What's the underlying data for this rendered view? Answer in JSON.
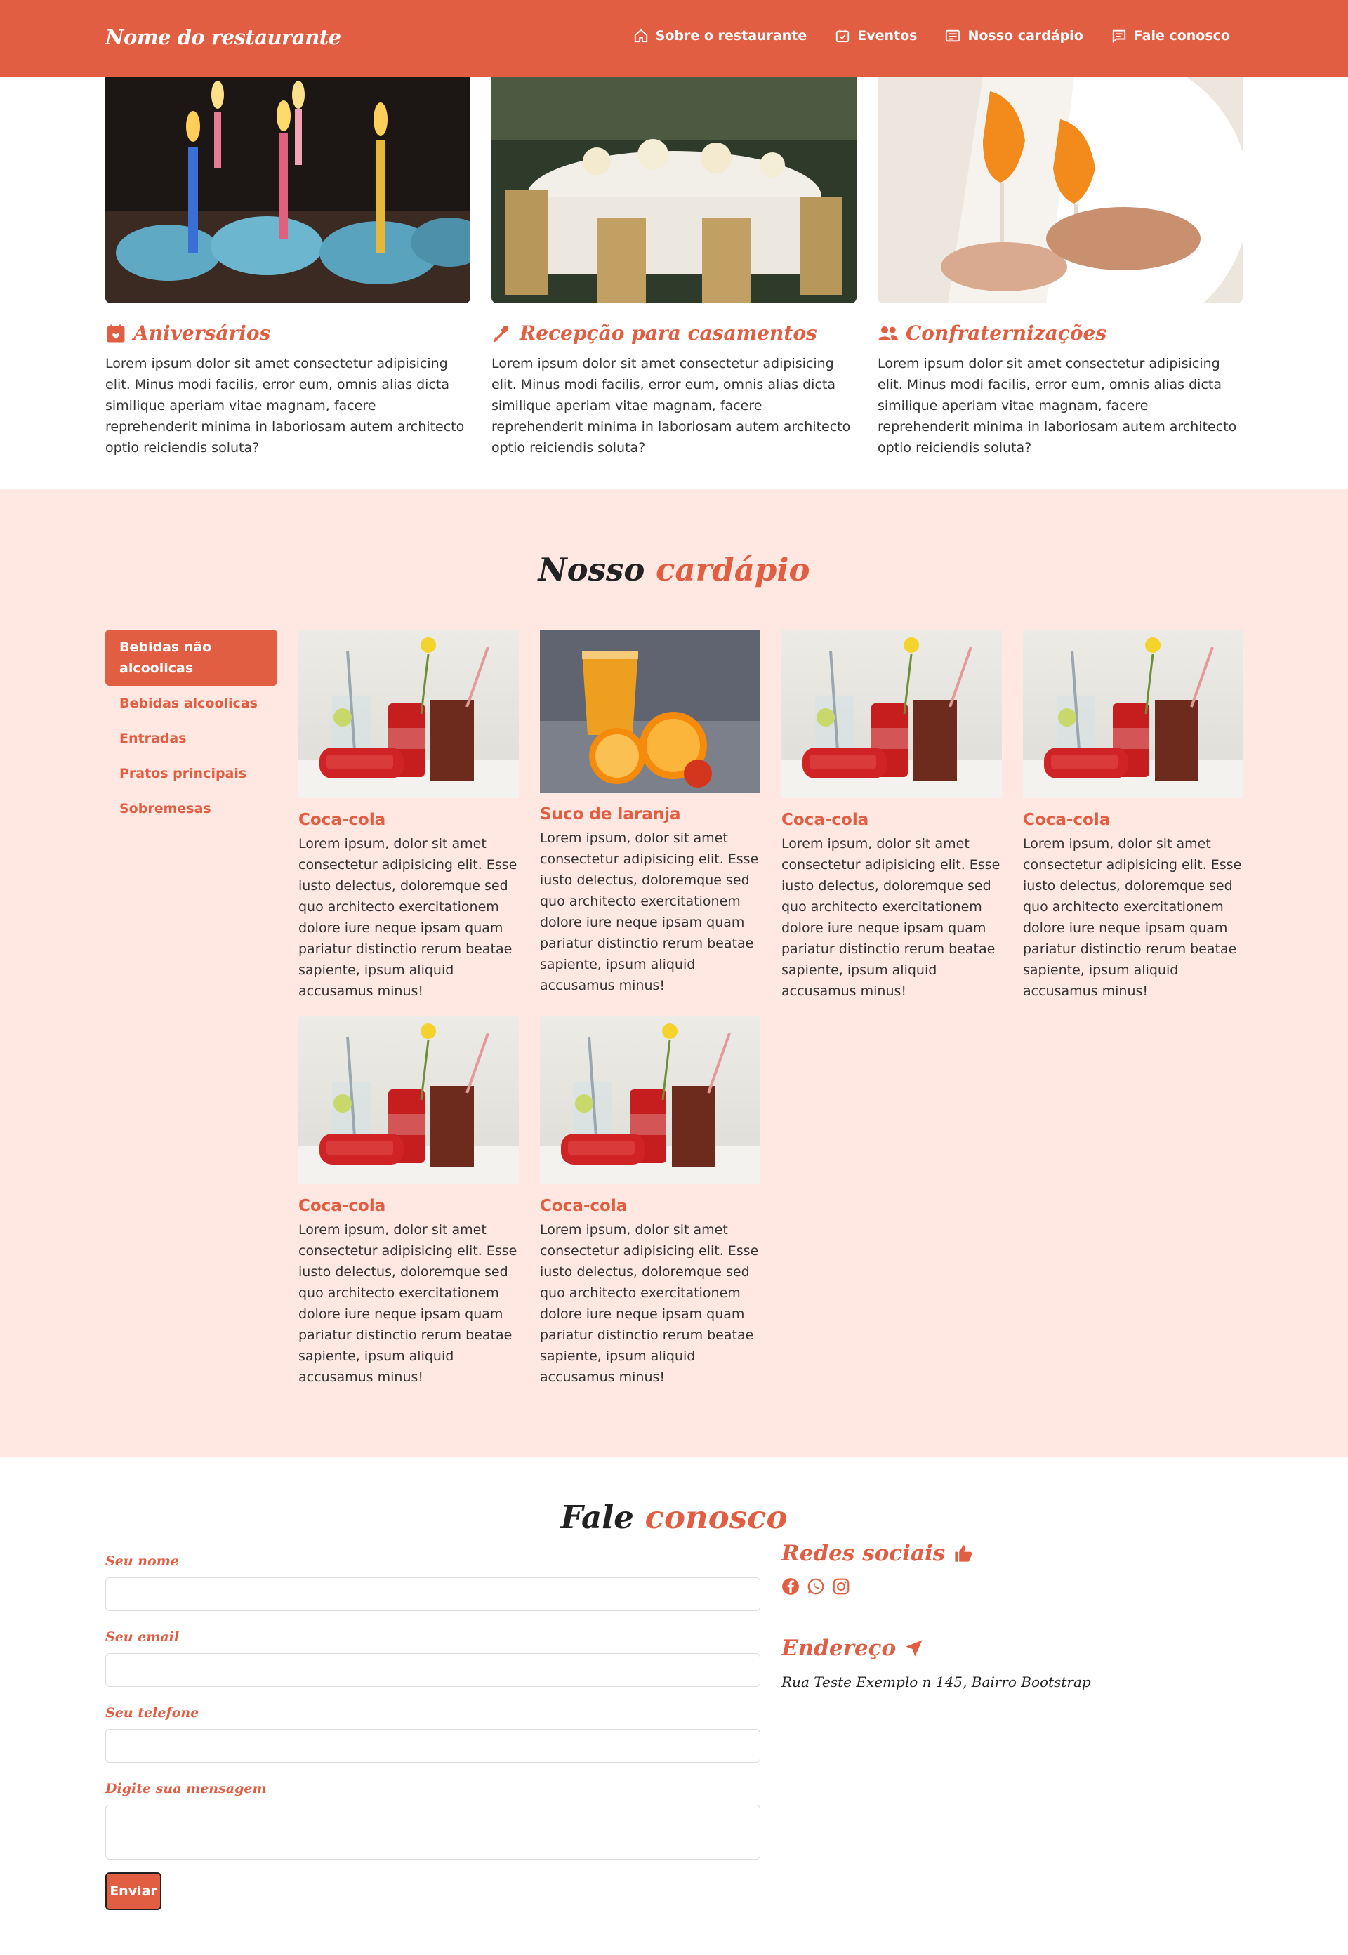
{
  "navbar": {
    "brand": "Nome do restaurante",
    "links": [
      {
        "label": "Sobre o restaurante",
        "icon": "house-icon"
      },
      {
        "label": "Eventos",
        "icon": "calendar-check-icon"
      },
      {
        "label": "Nosso cardápio",
        "icon": "card-text-icon"
      },
      {
        "label": "Fale conosco",
        "icon": "chat-icon"
      }
    ]
  },
  "events": [
    {
      "title": "Aniversários",
      "icon": "calendar-heart-icon",
      "text": "Lorem ipsum dolor sit amet consectetur adipisicing elit. Minus modi facilis, error eum, omnis alias dicta similique aperiam vitae magnam, facere reprehenderit minima in laboriosam autem architecto optio reiciendis soluta?"
    },
    {
      "title": "Recepção para casamentos",
      "icon": "hearts-arrow-icon",
      "text": "Lorem ipsum dolor sit amet consectetur adipisicing elit. Minus modi facilis, error eum, omnis alias dicta similique aperiam vitae magnam, facere reprehenderit minima in laboriosam autem architecto optio reiciendis soluta?"
    },
    {
      "title": "Confraternizações",
      "icon": "people-icon",
      "text": "Lorem ipsum dolor sit amet consectetur adipisicing elit. Minus modi facilis, error eum, omnis alias dicta similique aperiam vitae magnam, facere reprehenderit minima in laboriosam autem architecto optio reiciendis soluta?"
    }
  ],
  "menu": {
    "title_main": "Nosso",
    "title_accent": "cardápio",
    "categories": [
      "Bebidas não alcoolicas",
      "Bebidas alcoolicas",
      "Entradas",
      "Pratos principais",
      "Sobremesas"
    ],
    "items": [
      {
        "name": "Coca-cola",
        "text": "Lorem ipsum, dolor sit amet consectetur adipisicing elit. Esse iusto delectus, doloremque sed quo architecto exercitationem dolore iure neque ipsam quam pariatur distinctio rerum beatae sapiente, ipsum aliquid accusamus minus!"
      },
      {
        "name": "Suco de laranja",
        "text": "Lorem ipsum, dolor sit amet consectetur adipisicing elit. Esse iusto delectus, doloremque sed quo architecto exercitationem dolore iure neque ipsam quam pariatur distinctio rerum beatae sapiente, ipsum aliquid accusamus minus!"
      },
      {
        "name": "Coca-cola",
        "text": "Lorem ipsum, dolor sit amet consectetur adipisicing elit. Esse iusto delectus, doloremque sed quo architecto exercitationem dolore iure neque ipsam quam pariatur distinctio rerum beatae sapiente, ipsum aliquid accusamus minus!"
      },
      {
        "name": "Coca-cola",
        "text": "Lorem ipsum, dolor sit amet consectetur adipisicing elit. Esse iusto delectus, doloremque sed quo architecto exercitationem dolore iure neque ipsam quam pariatur distinctio rerum beatae sapiente, ipsum aliquid accusamus minus!"
      },
      {
        "name": "Coca-cola",
        "text": "Lorem ipsum, dolor sit amet consectetur adipisicing elit. Esse iusto delectus, doloremque sed quo architecto exercitationem dolore iure neque ipsam quam pariatur distinctio rerum beatae sapiente, ipsum aliquid accusamus minus!"
      },
      {
        "name": "Coca-cola",
        "text": "Lorem ipsum, dolor sit amet consectetur adipisicing elit. Esse iusto delectus, doloremque sed quo architecto exercitationem dolore iure neque ipsam quam pariatur distinctio rerum beatae sapiente, ipsum aliquid accusamus minus!"
      }
    ]
  },
  "contact": {
    "title_main": "Fale",
    "title_accent": "conosco",
    "labels": {
      "name": "Seu nome",
      "email": "Seu email",
      "phone": "Seu telefone",
      "message": "Digite sua mensagem"
    },
    "submit": "Enviar",
    "social_heading": "Redes sociais",
    "social_icons": [
      "facebook-icon",
      "whatsapp-icon",
      "instagram-icon"
    ],
    "address_heading": "Endereço",
    "address": "Rua Teste Exemplo n 145, Bairro Bootstrap"
  },
  "colors": {
    "accent": "#e15e42",
    "menu_bg": "#ffe8e2"
  }
}
